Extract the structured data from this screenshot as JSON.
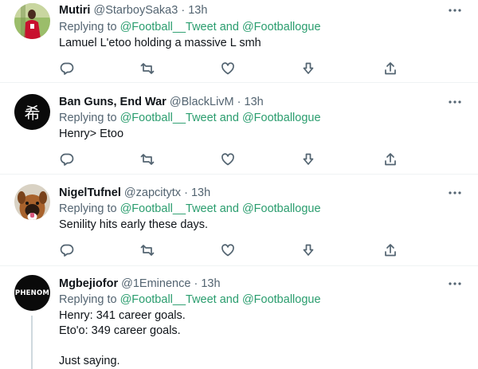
{
  "tweets": [
    {
      "name": "Mutiri",
      "handle": "@StarboySaka3",
      "separator": "·",
      "time": "13h",
      "reply_prefix": "Replying to ",
      "mention_1": "@Football__Tweet",
      "reply_joiner": " and ",
      "mention_2": "@Footballogue",
      "text": "Lamuel L'etoo holding a massive L smh",
      "avatar_icon": "player-photo-avatar"
    },
    {
      "name": "Ban Guns, End War",
      "handle": "@BlackLivM",
      "separator": "·",
      "time": "13h",
      "reply_prefix": "Replying to ",
      "mention_1": "@Football__Tweet",
      "reply_joiner": " and ",
      "mention_2": "@Footballogue",
      "text": "Henry> Etoo",
      "avatar_icon": "black-glyph-avatar",
      "avatar_glyph": "希"
    },
    {
      "name": "NigelTufnel",
      "handle": "@zapcitytx",
      "separator": "·",
      "time": "13h",
      "reply_prefix": "Replying to ",
      "mention_1": "@Football__Tweet",
      "reply_joiner": " and ",
      "mention_2": "@Footballogue",
      "text": "Senility hits early these days.",
      "avatar_icon": "dog-photo-avatar"
    },
    {
      "name": "Mgbejiofor",
      "handle": "@1Eminence",
      "separator": "·",
      "time": "13h",
      "reply_prefix": "Replying to ",
      "mention_1": "@Football__Tweet",
      "reply_joiner": " and ",
      "mention_2": "@Footballogue",
      "text": "Henry: 341 career goals.\nEto'o: 349 career goals.\n\nJust saying.",
      "avatar_icon": "phenom-logo-avatar",
      "avatar_label": "PHENOM"
    }
  ],
  "icons": {
    "more": "more-dots-icon",
    "reply": "reply-icon",
    "retweet": "retweet-icon",
    "like": "like-icon",
    "downvote": "downvote-icon",
    "share": "share-icon"
  },
  "colors": {
    "mention": "#2a9d6e",
    "secondary_text": "#536471",
    "primary_text": "#0f1419",
    "divider": "#eff3f4"
  }
}
